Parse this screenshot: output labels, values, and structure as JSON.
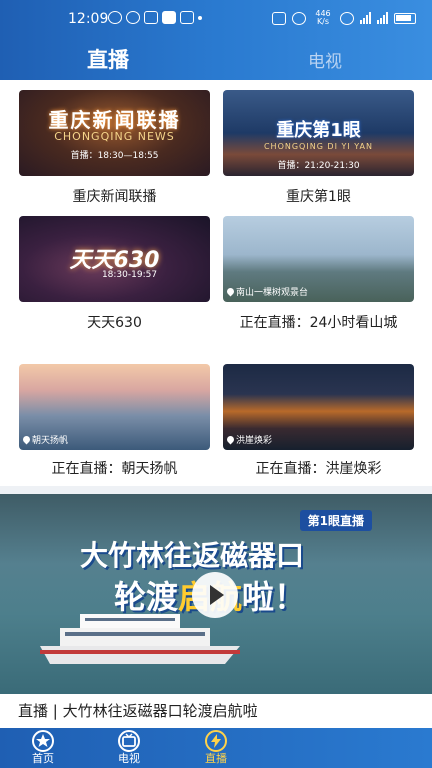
{
  "statusbar": {
    "time": "12:09",
    "netspeed_top": "446",
    "netspeed_bottom": "K/s"
  },
  "header": {
    "tabs": [
      {
        "label": "直播",
        "active": true
      },
      {
        "label": "电视",
        "active": false
      }
    ]
  },
  "grid": [
    {
      "caption": "重庆新闻联播",
      "thumb_title": "重庆新闻联播",
      "thumb_sub": "CHONGQING NEWS",
      "thumb_time": "首播：18:30—18:55"
    },
    {
      "caption": "重庆第1眼",
      "thumb_title": "重庆第1眼",
      "thumb_sub": "CHONGQING DI YI YAN",
      "thumb_time": "首播：21:20-21:30"
    },
    {
      "caption": "天天630",
      "thumb_title": "天天630",
      "thumb_time": "18:30-19:57"
    },
    {
      "caption": "正在直播：24小时看山城",
      "thumb_location": "南山一棵树观景台"
    },
    {
      "caption": "正在直播：朝天扬帆",
      "thumb_location": "朝天扬帆"
    },
    {
      "caption": "正在直播：洪崖焕彩",
      "thumb_location": "洪崖焕彩"
    }
  ],
  "banner": {
    "tag": "第1眼直播",
    "headline_line1": "大竹林往返磁器口",
    "headline_line2_a": "轮渡",
    "headline_line2_b": "启航",
    "headline_line2_c": "啦！",
    "caption": "直播 | 大竹林往返磁器口轮渡启航啦"
  },
  "bottom_nav": [
    {
      "label": "首页",
      "icon": "star-icon",
      "active": false
    },
    {
      "label": "电视",
      "icon": "tv-icon",
      "active": false
    },
    {
      "label": "直播",
      "icon": "lightning-icon",
      "active": true
    }
  ],
  "colors": {
    "brand_blue": "#2a7ad0",
    "active_yellow": "#ffd24a"
  }
}
